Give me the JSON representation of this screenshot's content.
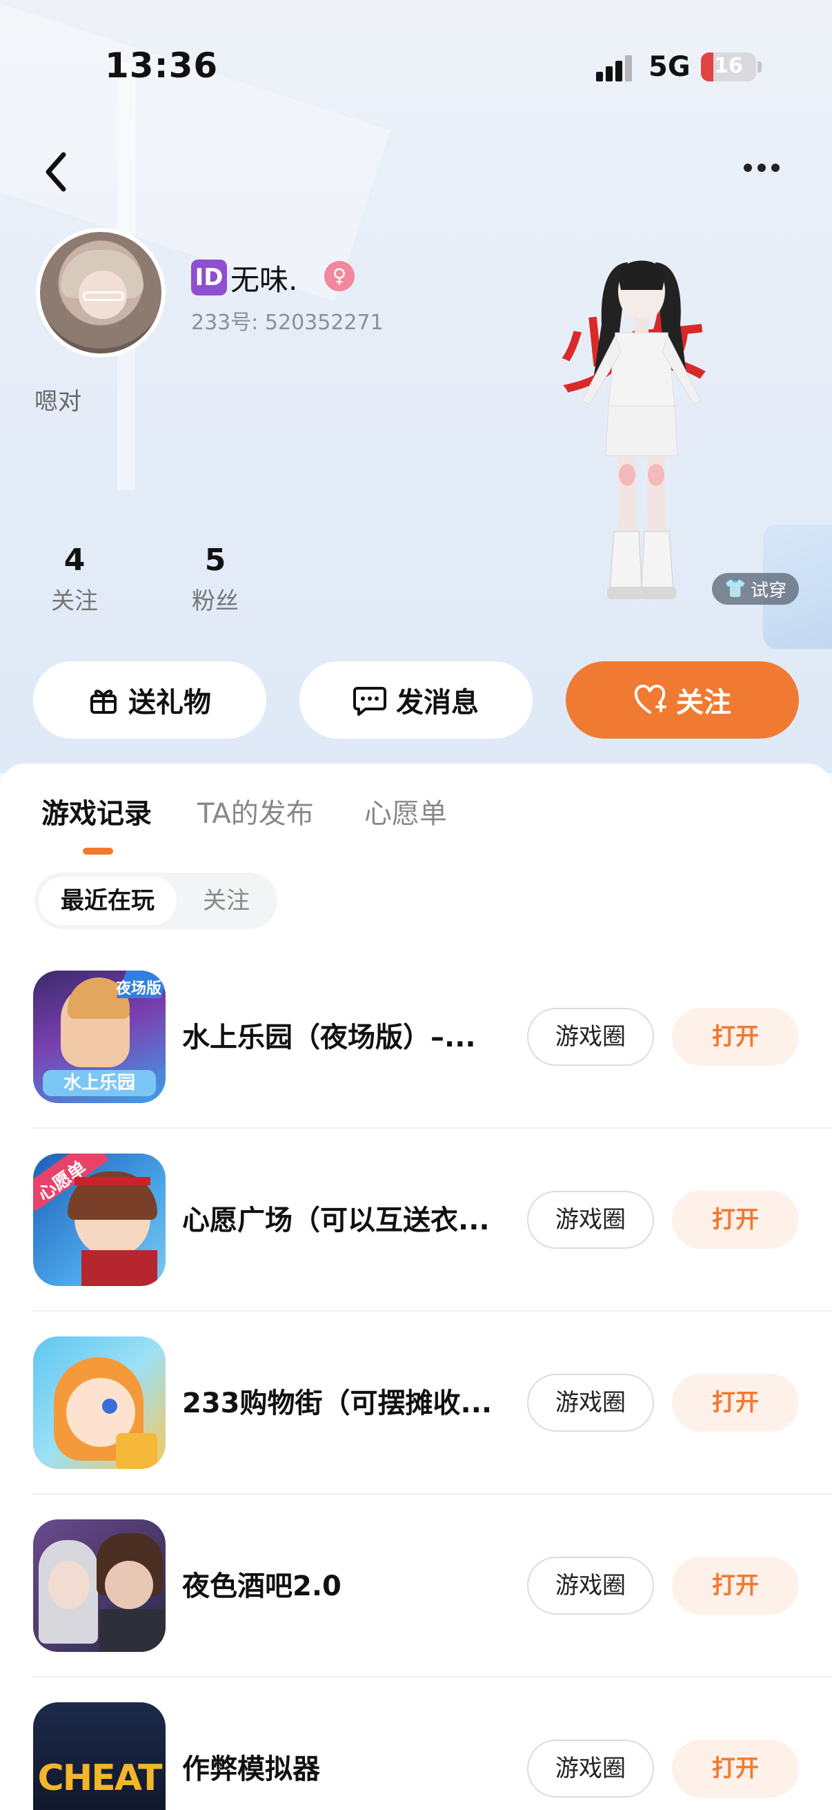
{
  "status": {
    "time": "13:36",
    "network": "5G",
    "battery": "16"
  },
  "profile": {
    "id_badge": "ID",
    "nickname": "无味.",
    "uid": "233号: 520352271",
    "bio": "嗯对",
    "avatar_desc": "user avatar",
    "character_title": "少女"
  },
  "stats": [
    {
      "num": "4",
      "label": "关注"
    },
    {
      "num": "5",
      "label": "粉丝"
    }
  ],
  "try_on": "试穿",
  "actions": {
    "gift": "送礼物",
    "message": "发消息",
    "follow": "关注"
  },
  "tabs": [
    "游戏记录",
    "TA的发布",
    "心愿单"
  ],
  "segments": [
    "最近在玩",
    "关注"
  ],
  "row_buttons": {
    "circle": "游戏圈",
    "open": "打开"
  },
  "games": [
    {
      "name": "水上乐园（夜场版）–...",
      "icon_text": "水上乐园",
      "badge": "夜场版"
    },
    {
      "name": "心愿广场（可以互送衣...",
      "icon_text": "",
      "badge": "心愿单"
    },
    {
      "name": "233购物街（可摆摊收...",
      "icon_text": "",
      "badge": ""
    },
    {
      "name": "夜色酒吧2.0",
      "icon_text": "",
      "badge": ""
    },
    {
      "name": "作弊模拟器",
      "icon_text": "CHEAT",
      "badge": ""
    }
  ],
  "colors": {
    "accent": "#f07a32",
    "id_purple": "#8e4fd0",
    "gender_pink": "#f2879d"
  }
}
